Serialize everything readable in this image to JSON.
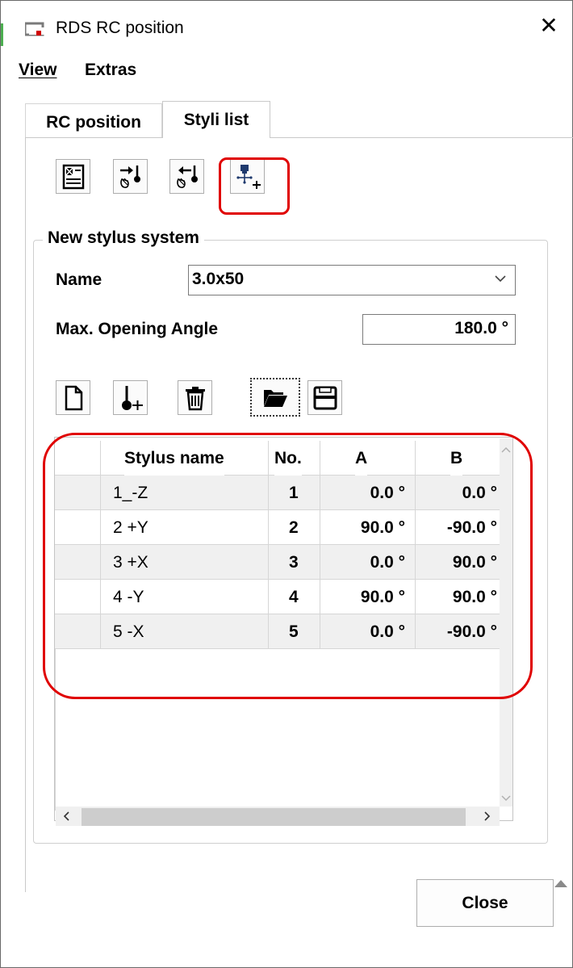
{
  "window": {
    "title": "RDS RC position",
    "close_glyph": "✕"
  },
  "menu": {
    "view": "View",
    "extras": "Extras"
  },
  "tabs": [
    {
      "label": "RC position",
      "active": false
    },
    {
      "label": "Styli list",
      "active": true
    }
  ],
  "toolbar_top": [
    {
      "icon": "calculator-list-icon"
    },
    {
      "icon": "import-stylus-icon"
    },
    {
      "icon": "export-stylus-icon"
    },
    {
      "icon": "add-stylus-system-icon"
    }
  ],
  "group": {
    "legend": "New stylus system",
    "name_label": "Name",
    "name_value": "3.0x50",
    "angle_label": "Max. Opening Angle",
    "angle_value": "180.0 °"
  },
  "toolbar_table": [
    {
      "icon": "new-file-icon"
    },
    {
      "icon": "add-stylus-icon"
    },
    {
      "icon": "delete-icon"
    },
    {
      "icon": "open-folder-icon"
    },
    {
      "icon": "save-icon"
    }
  ],
  "table": {
    "columns": [
      "Stylus name",
      "No.",
      "A",
      "B"
    ],
    "rows": [
      {
        "name": "1_-Z",
        "no": "1",
        "a": "0.0 °",
        "b": "0.0 °"
      },
      {
        "name": "2 +Y",
        "no": "2",
        "a": "90.0 °",
        "b": "-90.0 °"
      },
      {
        "name": "3 +X",
        "no": "3",
        "a": "0.0 °",
        "b": "90.0 °"
      },
      {
        "name": "4 -Y",
        "no": "4",
        "a": "90.0 °",
        "b": "90.0 °"
      },
      {
        "name": "5 -X",
        "no": "5",
        "a": "0.0 °",
        "b": "-90.0 °"
      }
    ]
  },
  "buttons": {
    "close": "Close"
  },
  "colors": {
    "highlight": "#e00000",
    "icon_blue": "#1f3a6e"
  }
}
